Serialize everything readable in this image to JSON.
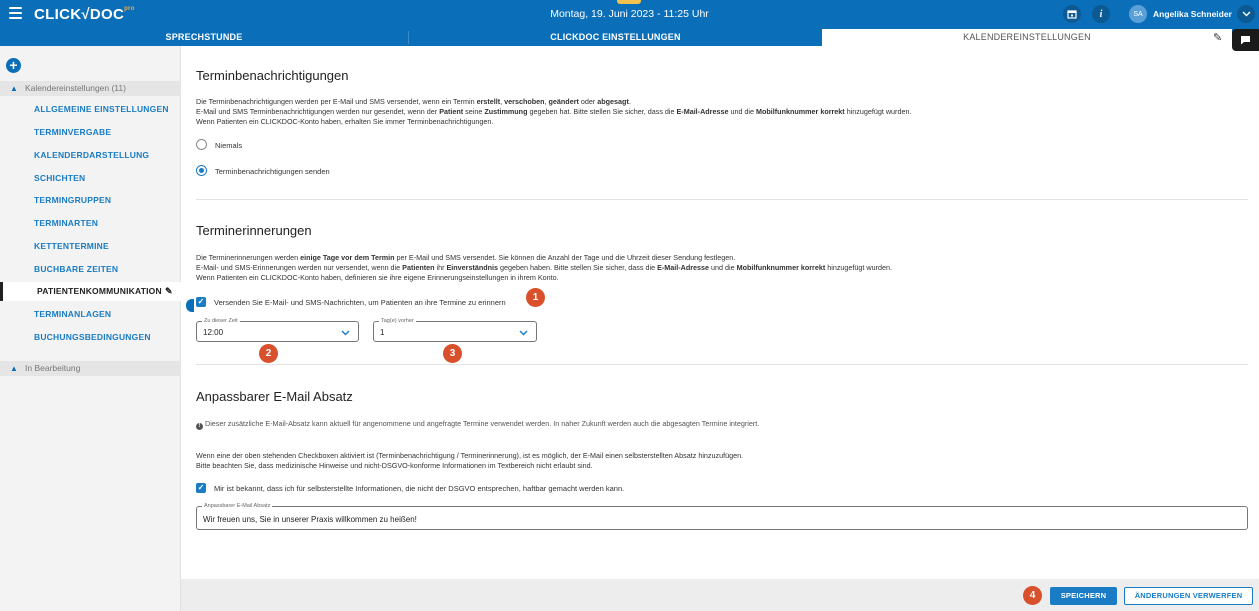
{
  "app": {
    "logo_text": "CLICK√DOC",
    "logo_suffix": "pro",
    "datetime": "Montag, 19. Juni 2023 - 11:25 Uhr",
    "user_initials": "SA",
    "user_name": "Angelika Schneider"
  },
  "tabs": [
    {
      "label": "SPRECHSTUNDE"
    },
    {
      "label": "CLICKDOC EINSTELLUNGEN"
    },
    {
      "label": "KALENDEREINSTELLUNGEN"
    }
  ],
  "sidebar": {
    "group1": "Kalendereinstellungen (11)",
    "items": [
      {
        "label": "ALLGEMEINE EINSTELLUNGEN"
      },
      {
        "label": "TERMINVERGABE"
      },
      {
        "label": "KALENDERDARSTELLUNG"
      },
      {
        "label": "SCHICHTEN"
      },
      {
        "label": "TERMINGRUPPEN"
      },
      {
        "label": "TERMINARTEN"
      },
      {
        "label": "KETTENTERMINE"
      },
      {
        "label": "BUCHBARE ZEITEN"
      },
      {
        "label": "PATIENTENKOMMUNIKATION"
      },
      {
        "label": "TERMINANLAGEN"
      },
      {
        "label": "BUCHUNGSBEDINGUNGEN"
      }
    ],
    "group2": "In Bearbeitung"
  },
  "notifications": {
    "title": "Terminbenachrichtigungen",
    "line1_a": "Die Terminbenachrichtigungen werden per E-Mail und SMS versendet, wenn ein Termin ",
    "line1_b": "erstellt",
    "line1_c": ", ",
    "line1_d": "verschoben",
    "line1_e": ", ",
    "line1_f": "geändert",
    "line1_g": " oder ",
    "line1_h": "abgesagt",
    "line1_i": ".",
    "line2_a": "E-Mail und SMS Terminbenachrichtigungen werden nur gesendet, wenn der ",
    "line2_b": "Patient",
    "line2_c": " seine ",
    "line2_d": "Zustimmung",
    "line2_e": " gegeben hat. Bitte stellen Sie sicher, dass die ",
    "line2_f": "E-Mail-Adresse",
    "line2_g": " und die ",
    "line2_h": "Mobilfunknummer korrekt",
    "line2_i": " hinzugefügt wurden.",
    "line3": "Wenn Patienten ein CLICKDOC-Konto haben, erhalten Sie immer Terminbenachrichtigungen.",
    "option_never": "Niemals",
    "option_send": "Terminbenachrichtigungen senden"
  },
  "reminders": {
    "title": "Terminerinnerungen",
    "line1_a": "Die Terminerinnerungen werden ",
    "line1_b": "einige Tage vor dem Termin",
    "line1_c": " per E-Mail und SMS versendet. Sie können die Anzahl der Tage und die Uhrzeit dieser Sendung festlegen.",
    "line2_a": "E-Mail- und SMS-Erinnerungen werden nur versendet, wenn die ",
    "line2_b": "Patienten",
    "line2_c": " ihr ",
    "line2_d": "Einverständnis",
    "line2_e": " gegeben haben. Bitte stellen Sie sicher, dass die ",
    "line2_f": "E-Mail-Adresse",
    "line2_g": " und die ",
    "line2_h": "Mobilfunknummer korrekt",
    "line2_i": " hinzugefügt wurden.",
    "line3": "Wenn Patienten ein CLICKDOC-Konto haben, definieren sie ihre eigene Erinnerungseinstellungen in ihrem Konto.",
    "checkbox_label": "Versenden Sie E-Mail- und SMS-Nachrichten, um Patienten an ihre Termine zu erinnern",
    "time_legend": "Zu dieser Zeit",
    "time_value": "12:00",
    "days_legend": "Tag(e) vorher",
    "days_value": "1"
  },
  "custom_email": {
    "title": "Anpassbarer E-Mail Absatz",
    "info": "Dieser zusätzliche E-Mail-Absatz kann aktuell für angenommene und angefragte Termine verwendet werden. In naher Zukunft werden auch die abgesagten Termine integriert.",
    "line1": "Wenn eine der oben stehenden Checkboxen aktiviert ist (Terminbenachrichtigung / Terminerinnerung), ist es möglich, der E-Mail einen selbsterstellten Absatz hinzuzufügen.",
    "line2": "Bitte beachten Sie, dass medizinische Hinweise und nicht-DSGVO-konforme Informationen im Textbereich nicht erlaubt sind.",
    "checkbox_label": "Mir ist bekannt, dass ich für selbsterstellte Informationen, die nicht der DSGVO entsprechen, haftbar gemacht werden kann.",
    "field_legend": "Anpassbarer E-Mail Absatz",
    "field_value": "Wir freuen uns, Sie in unserer Praxis willkommen zu heißen!"
  },
  "badges": [
    "1",
    "2",
    "3",
    "4"
  ],
  "footer": {
    "save": "SPEICHERN",
    "discard": "ÄNDERUNGEN VERWERFEN"
  },
  "colors": {
    "brand_blue": "#0a6fb8",
    "link_blue": "#1a7cc4",
    "badge_orange": "#d9512c"
  }
}
